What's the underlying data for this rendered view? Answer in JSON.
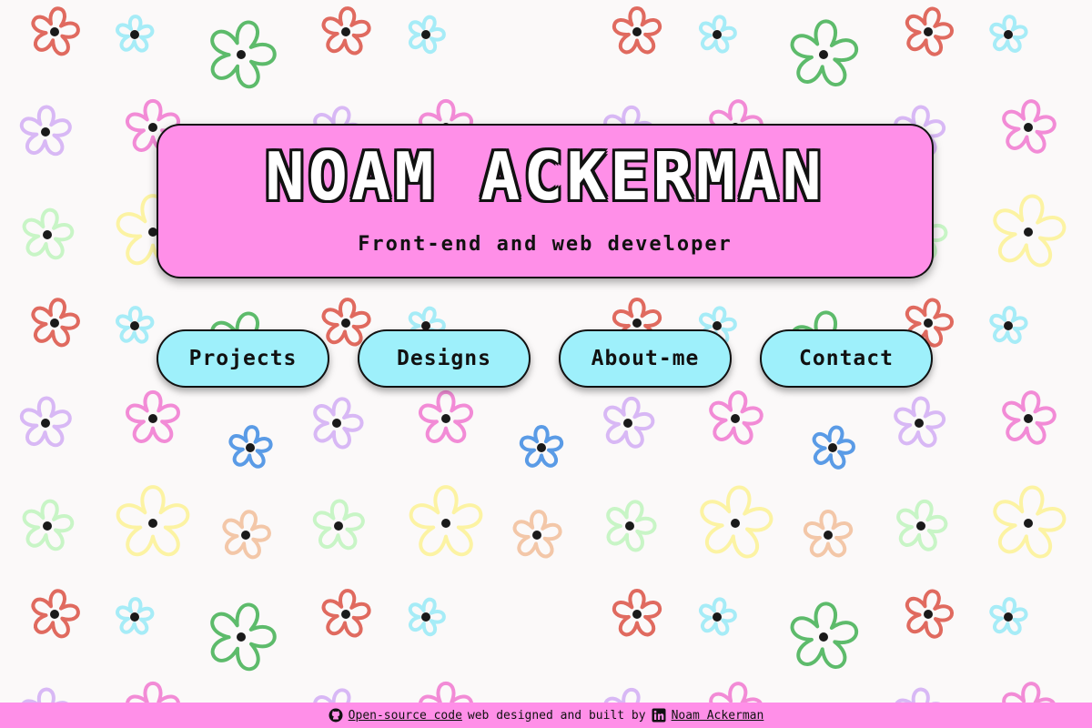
{
  "hero": {
    "title": "NOAM ACKERMAN",
    "subtitle": "Front-end and web developer"
  },
  "nav": {
    "projects": "Projects",
    "designs": "Designs",
    "about": "About-me",
    "contact": "Contact"
  },
  "footer": {
    "source_link": "Open-source code",
    "middle_text": "web designed and built by",
    "author_link": "Noam Ackerman",
    "left_icon": "github-icon",
    "right_icon": "linkedin-icon"
  },
  "background": {
    "pattern": "hand-drawn flowers",
    "colors": [
      "#e06a5f",
      "#a6ecf7",
      "#5dbb6b",
      "#d8b8f5",
      "#f28bd6",
      "#c8f5c6",
      "#fcf3a3",
      "#5a9be6",
      "#f3c7a8"
    ]
  },
  "colors": {
    "page_background": "#fbf9f9",
    "hero_background": "#ff8fe8",
    "button_background": "#9ef0fb",
    "footer_background": "#ff8fe8"
  }
}
